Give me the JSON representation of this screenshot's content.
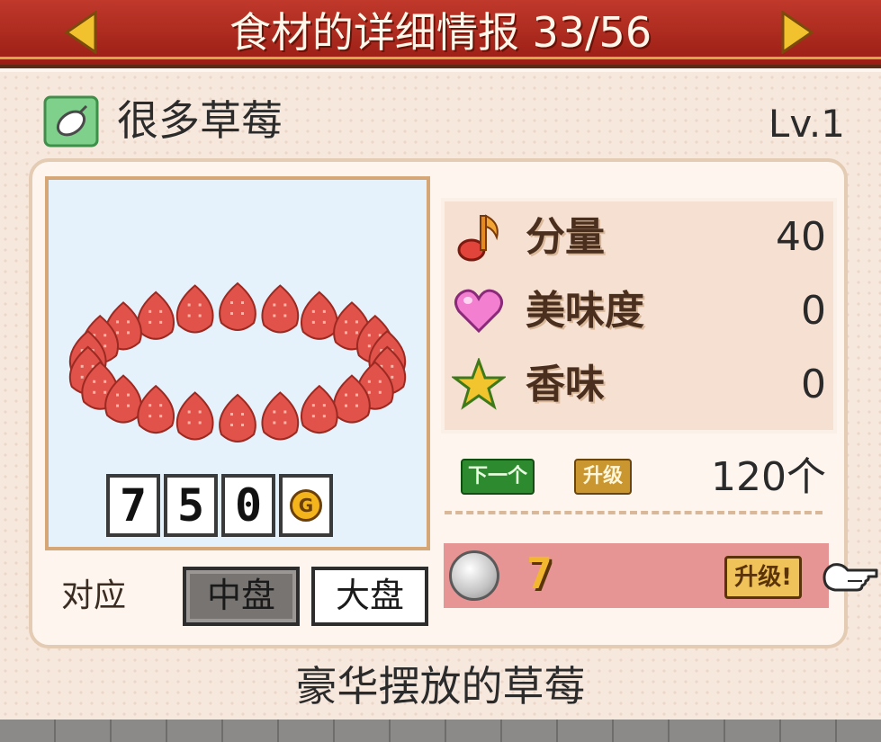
{
  "header": {
    "title": "食材的详细情报 33/56",
    "prev_icon": "triangle-left-icon",
    "next_icon": "triangle-right-icon"
  },
  "item": {
    "category_icon": "ingredient-category-icon",
    "name": "很多草莓",
    "level": "Lv.1",
    "price_digits": [
      "7",
      "5",
      "0"
    ],
    "currency": "G",
    "description": "豪华摆放的草莓"
  },
  "compatibility": {
    "label": "对应",
    "options": [
      "中盘",
      "大盘"
    ],
    "selected": "中盘"
  },
  "stats": [
    {
      "icon": "music-note-icon",
      "label": "分量",
      "value": "40"
    },
    {
      "icon": "heart-icon",
      "label": "美味度",
      "value": "0"
    },
    {
      "icon": "star-icon",
      "label": "香味",
      "value": "0"
    }
  ],
  "next_upgrade": {
    "next_label": "下一个",
    "upgrade_label": "升级",
    "count": "120个"
  },
  "upgrade": {
    "coin_icon": "silver-coin-icon",
    "cost": "7",
    "button_label": "升级!",
    "pointer_icon": "pointing-hand-icon"
  },
  "colors": {
    "header_red": "#b02a1e",
    "upgrade_bar": "#e79494",
    "panel_bg": "#f7e8de"
  }
}
